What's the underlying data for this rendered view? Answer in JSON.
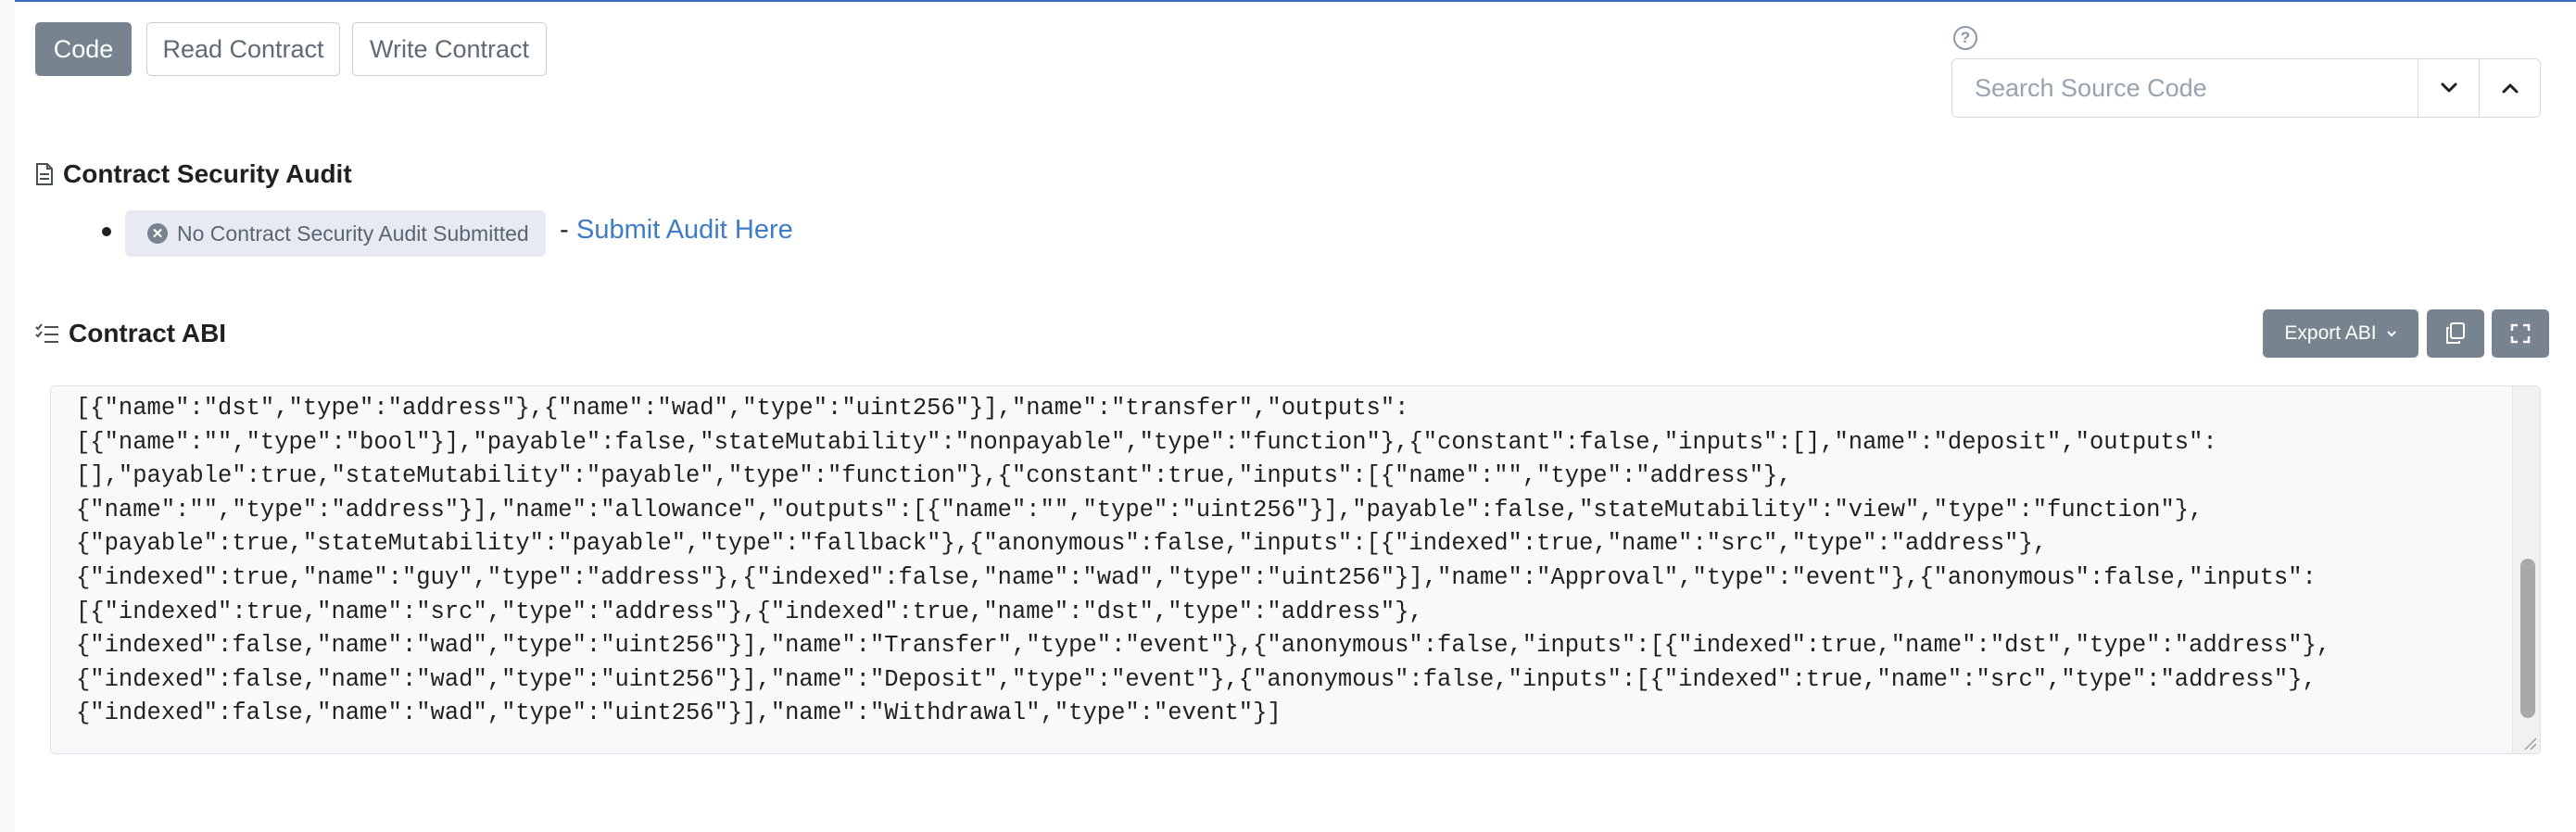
{
  "tabs": [
    {
      "label": "Code",
      "active": true
    },
    {
      "label": "Read Contract",
      "active": false
    },
    {
      "label": "Write Contract",
      "active": false
    }
  ],
  "search": {
    "placeholder": "Search Source Code",
    "help_icon": "question-circle-icon",
    "next_icon": "chevron-down-icon",
    "prev_icon": "chevron-up-icon"
  },
  "audit": {
    "title": "Contract Security Audit",
    "badge": "No Contract Security Audit Submitted",
    "separator": "-",
    "link": "Submit Audit Here"
  },
  "abi": {
    "title": "Contract ABI",
    "export_label": "Export ABI",
    "copy_icon": "copy-icon",
    "fullscreen_icon": "expand-icon",
    "lines": [
      "[{\"name\":\"dst\",\"type\":\"address\"},{\"name\":\"wad\",\"type\":\"uint256\"}],\"name\":\"transfer\",\"outputs\":",
      "[{\"name\":\"\",\"type\":\"bool\"}],\"payable\":false,\"stateMutability\":\"nonpayable\",\"type\":\"function\"},{\"constant\":false,\"inputs\":[],\"name\":\"deposit\",\"outputs\":",
      "[],\"payable\":true,\"stateMutability\":\"payable\",\"type\":\"function\"},{\"constant\":true,\"inputs\":[{\"name\":\"\",\"type\":\"address\"},",
      "{\"name\":\"\",\"type\":\"address\"}],\"name\":\"allowance\",\"outputs\":[{\"name\":\"\",\"type\":\"uint256\"}],\"payable\":false,\"stateMutability\":\"view\",\"type\":\"function\"},",
      "{\"payable\":true,\"stateMutability\":\"payable\",\"type\":\"fallback\"},{\"anonymous\":false,\"inputs\":[{\"indexed\":true,\"name\":\"src\",\"type\":\"address\"},",
      "{\"indexed\":true,\"name\":\"guy\",\"type\":\"address\"},{\"indexed\":false,\"name\":\"wad\",\"type\":\"uint256\"}],\"name\":\"Approval\",\"type\":\"event\"},{\"anonymous\":false,\"inputs\":",
      "[{\"indexed\":true,\"name\":\"src\",\"type\":\"address\"},{\"indexed\":true,\"name\":\"dst\",\"type\":\"address\"},",
      "{\"indexed\":false,\"name\":\"wad\",\"type\":\"uint256\"}],\"name\":\"Transfer\",\"type\":\"event\"},{\"anonymous\":false,\"inputs\":[{\"indexed\":true,\"name\":\"dst\",\"type\":\"address\"},",
      "{\"indexed\":false,\"name\":\"wad\",\"type\":\"uint256\"}],\"name\":\"Deposit\",\"type\":\"event\"},{\"anonymous\":false,\"inputs\":[{\"indexed\":true,\"name\":\"src\",\"type\":\"address\"},",
      "{\"indexed\":false,\"name\":\"wad\",\"type\":\"uint256\"}],\"name\":\"Withdrawal\",\"type\":\"event\"}]"
    ]
  }
}
